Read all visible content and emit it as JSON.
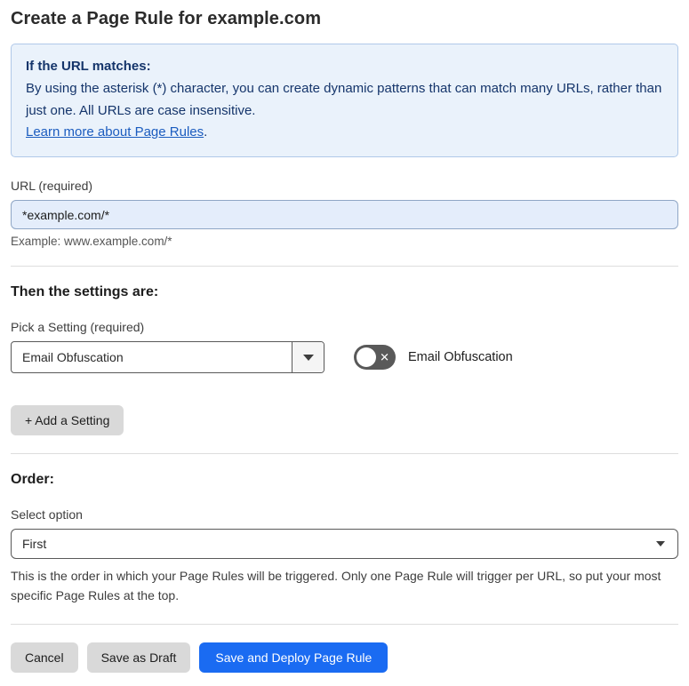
{
  "page": {
    "title": "Create a Page Rule for example.com"
  },
  "info_box": {
    "heading": "If the URL matches:",
    "body": "By using the asterisk (*) character, you can create dynamic patterns that can match many URLs, rather than just one. All URLs are case insensitive.",
    "link_label": "Learn more about Page Rules",
    "link_suffix": "."
  },
  "url_section": {
    "label": "URL (required)",
    "value": "*example.com/*",
    "help": "Example: www.example.com/*"
  },
  "settings_section": {
    "heading": "Then the settings are:",
    "picker_label": "Pick a Setting (required)",
    "picker_value": "Email Obfuscation",
    "toggle_label": "Email Obfuscation",
    "toggle_state": "off",
    "toggle_glyph": "✕",
    "add_button": "+ Add a Setting"
  },
  "order_section": {
    "heading": "Order:",
    "select_label": "Select option",
    "select_value": "First",
    "description": "This is the order in which your Page Rules will be triggered. Only one Page Rule will trigger per URL, so put your most specific Page Rules at the top."
  },
  "footer": {
    "cancel": "Cancel",
    "save_draft": "Save as Draft",
    "save_deploy": "Save and Deploy Page Rule"
  },
  "colors": {
    "accent_blue": "#1a6bf2",
    "info_bg": "#eaf2fb",
    "info_border": "#b0c9e9",
    "info_text": "#15356b",
    "link_blue": "#1b5cbf",
    "input_bg": "#e4edfb",
    "toggle_bg": "#595959",
    "button_gray": "#d9d9d9"
  }
}
